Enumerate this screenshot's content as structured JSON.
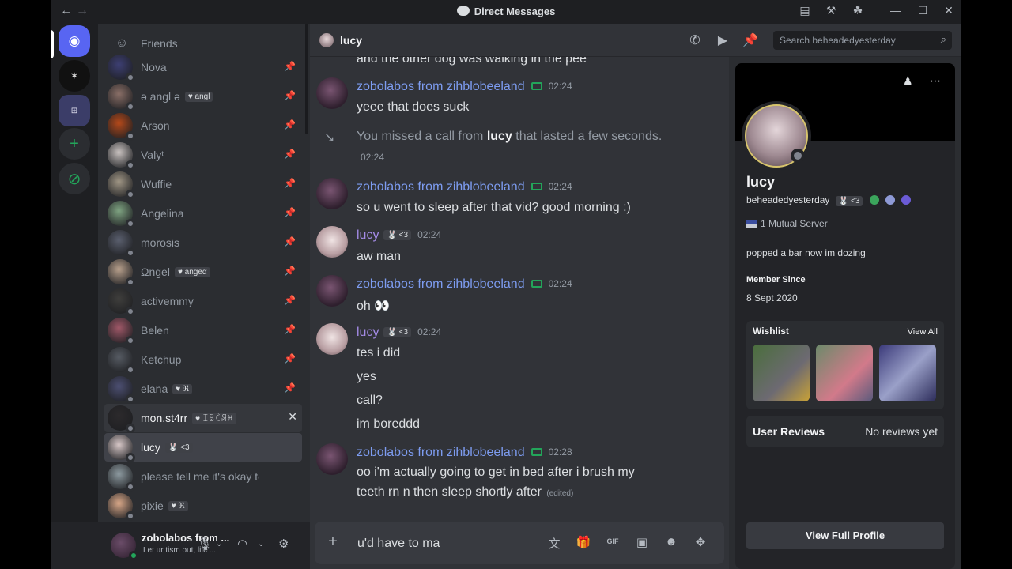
{
  "window": {
    "title": "Direct Messages",
    "back": "←",
    "forward": "→",
    "controls": [
      "—",
      "☐",
      "✕"
    ]
  },
  "sidebar": {
    "friends_label": "Friends",
    "dms": [
      {
        "name": "Nova",
        "tag": "",
        "color": "#3d3f73"
      },
      {
        "name": "ə angl ə",
        "tag": "♥ angl",
        "color": "#8a6f67"
      },
      {
        "name": "Arson",
        "tag": "",
        "color": "#b4491a"
      },
      {
        "name": "Valyᵗ",
        "tag": "",
        "color": "#c9c2c0"
      },
      {
        "name": "Wuffie",
        "tag": "",
        "color": "#a09685"
      },
      {
        "name": "Angelina",
        "tag": "",
        "color": "#7fa482"
      },
      {
        "name": "morosis",
        "tag": "",
        "color": "#5a5f6e"
      },
      {
        "name": "Ωngel",
        "tag": "♥ angeα",
        "color": "#b8a08c"
      },
      {
        "name": "activemmy",
        "tag": "",
        "color": "#3f3e3c"
      },
      {
        "name": "Belen",
        "tag": "",
        "color": "#a05868"
      },
      {
        "name": "Ketchup",
        "tag": "",
        "color": "#565b63"
      },
      {
        "name": "elana",
        "tag": "♥ ℜ",
        "color": "#4c4f72"
      },
      {
        "name": "mon.st4rr",
        "tag": "♥ ꀤꌗꉓꋪꁝ",
        "color": "#2c2a2c"
      },
      {
        "name": "lucy",
        "tag": "🐰 <3",
        "color": "#d8c8c8"
      },
      {
        "name": "please tell me it's okay to cry",
        "tag": "",
        "color": "#8d9aa0"
      },
      {
        "name": "pixie",
        "tag": "♥ ℜ",
        "color": "#d8a788"
      }
    ]
  },
  "user_panel": {
    "username": "zobolabos from ...",
    "status": "Let ur tism out, life'..."
  },
  "chat": {
    "recipient": "lucy",
    "search_placeholder": "Search beheadedyesterday",
    "top_partial": "and the other dog was walking in the pee",
    "messages": [
      {
        "author": "zobolabos from zihblobeeland",
        "time": "02:24",
        "lines": [
          "yeee that does suck"
        ]
      },
      {
        "system": "You missed a call from",
        "system_name": "lucy",
        "system_end": "that lasted a few seconds.",
        "time": "02:24"
      },
      {
        "author": "zobolabos from zihblobeeland",
        "time": "02:24",
        "lines": [
          "so u went to sleep after that vid? good morning :)"
        ]
      },
      {
        "author": "lucy",
        "tag": "🐰 <3",
        "time": "02:24",
        "lines": [
          "aw man"
        ]
      },
      {
        "author": "zobolabos from zihblobeeland",
        "time": "02:24",
        "lines": [
          "oh 👀"
        ]
      },
      {
        "author": "lucy",
        "tag": "🐰 <3",
        "time": "02:24",
        "lines": [
          "tes i did",
          "yes",
          "call?",
          "im boreddd"
        ]
      },
      {
        "author": "zobolabos from zihblobeeland",
        "time": "02:28",
        "lines": [
          "oo i'm actually going to get in bed after i brush my",
          "teeth rn n then sleep shortly after"
        ],
        "edited": "(edited)"
      }
    ],
    "composer_value": "u'd have to ma"
  },
  "profile": {
    "display_name": "lucy",
    "username": "beheadedyesterday",
    "tag": "🐰 <3",
    "mutual": "1 Mutual Server",
    "bio": "popped a bar now im dozing",
    "member_since_label": "Member Since",
    "member_since": "8 Sept 2020",
    "wishlist_label": "Wishlist",
    "view_all": "View All",
    "reviews_label": "User Reviews",
    "reviews_value": "No reviews yet",
    "view_full": "View Full Profile"
  },
  "colors": {
    "accent": "#5865f2",
    "online": "#23a55a",
    "author_zob": "#7d9cf0",
    "author_lucy": "#a48be6"
  }
}
